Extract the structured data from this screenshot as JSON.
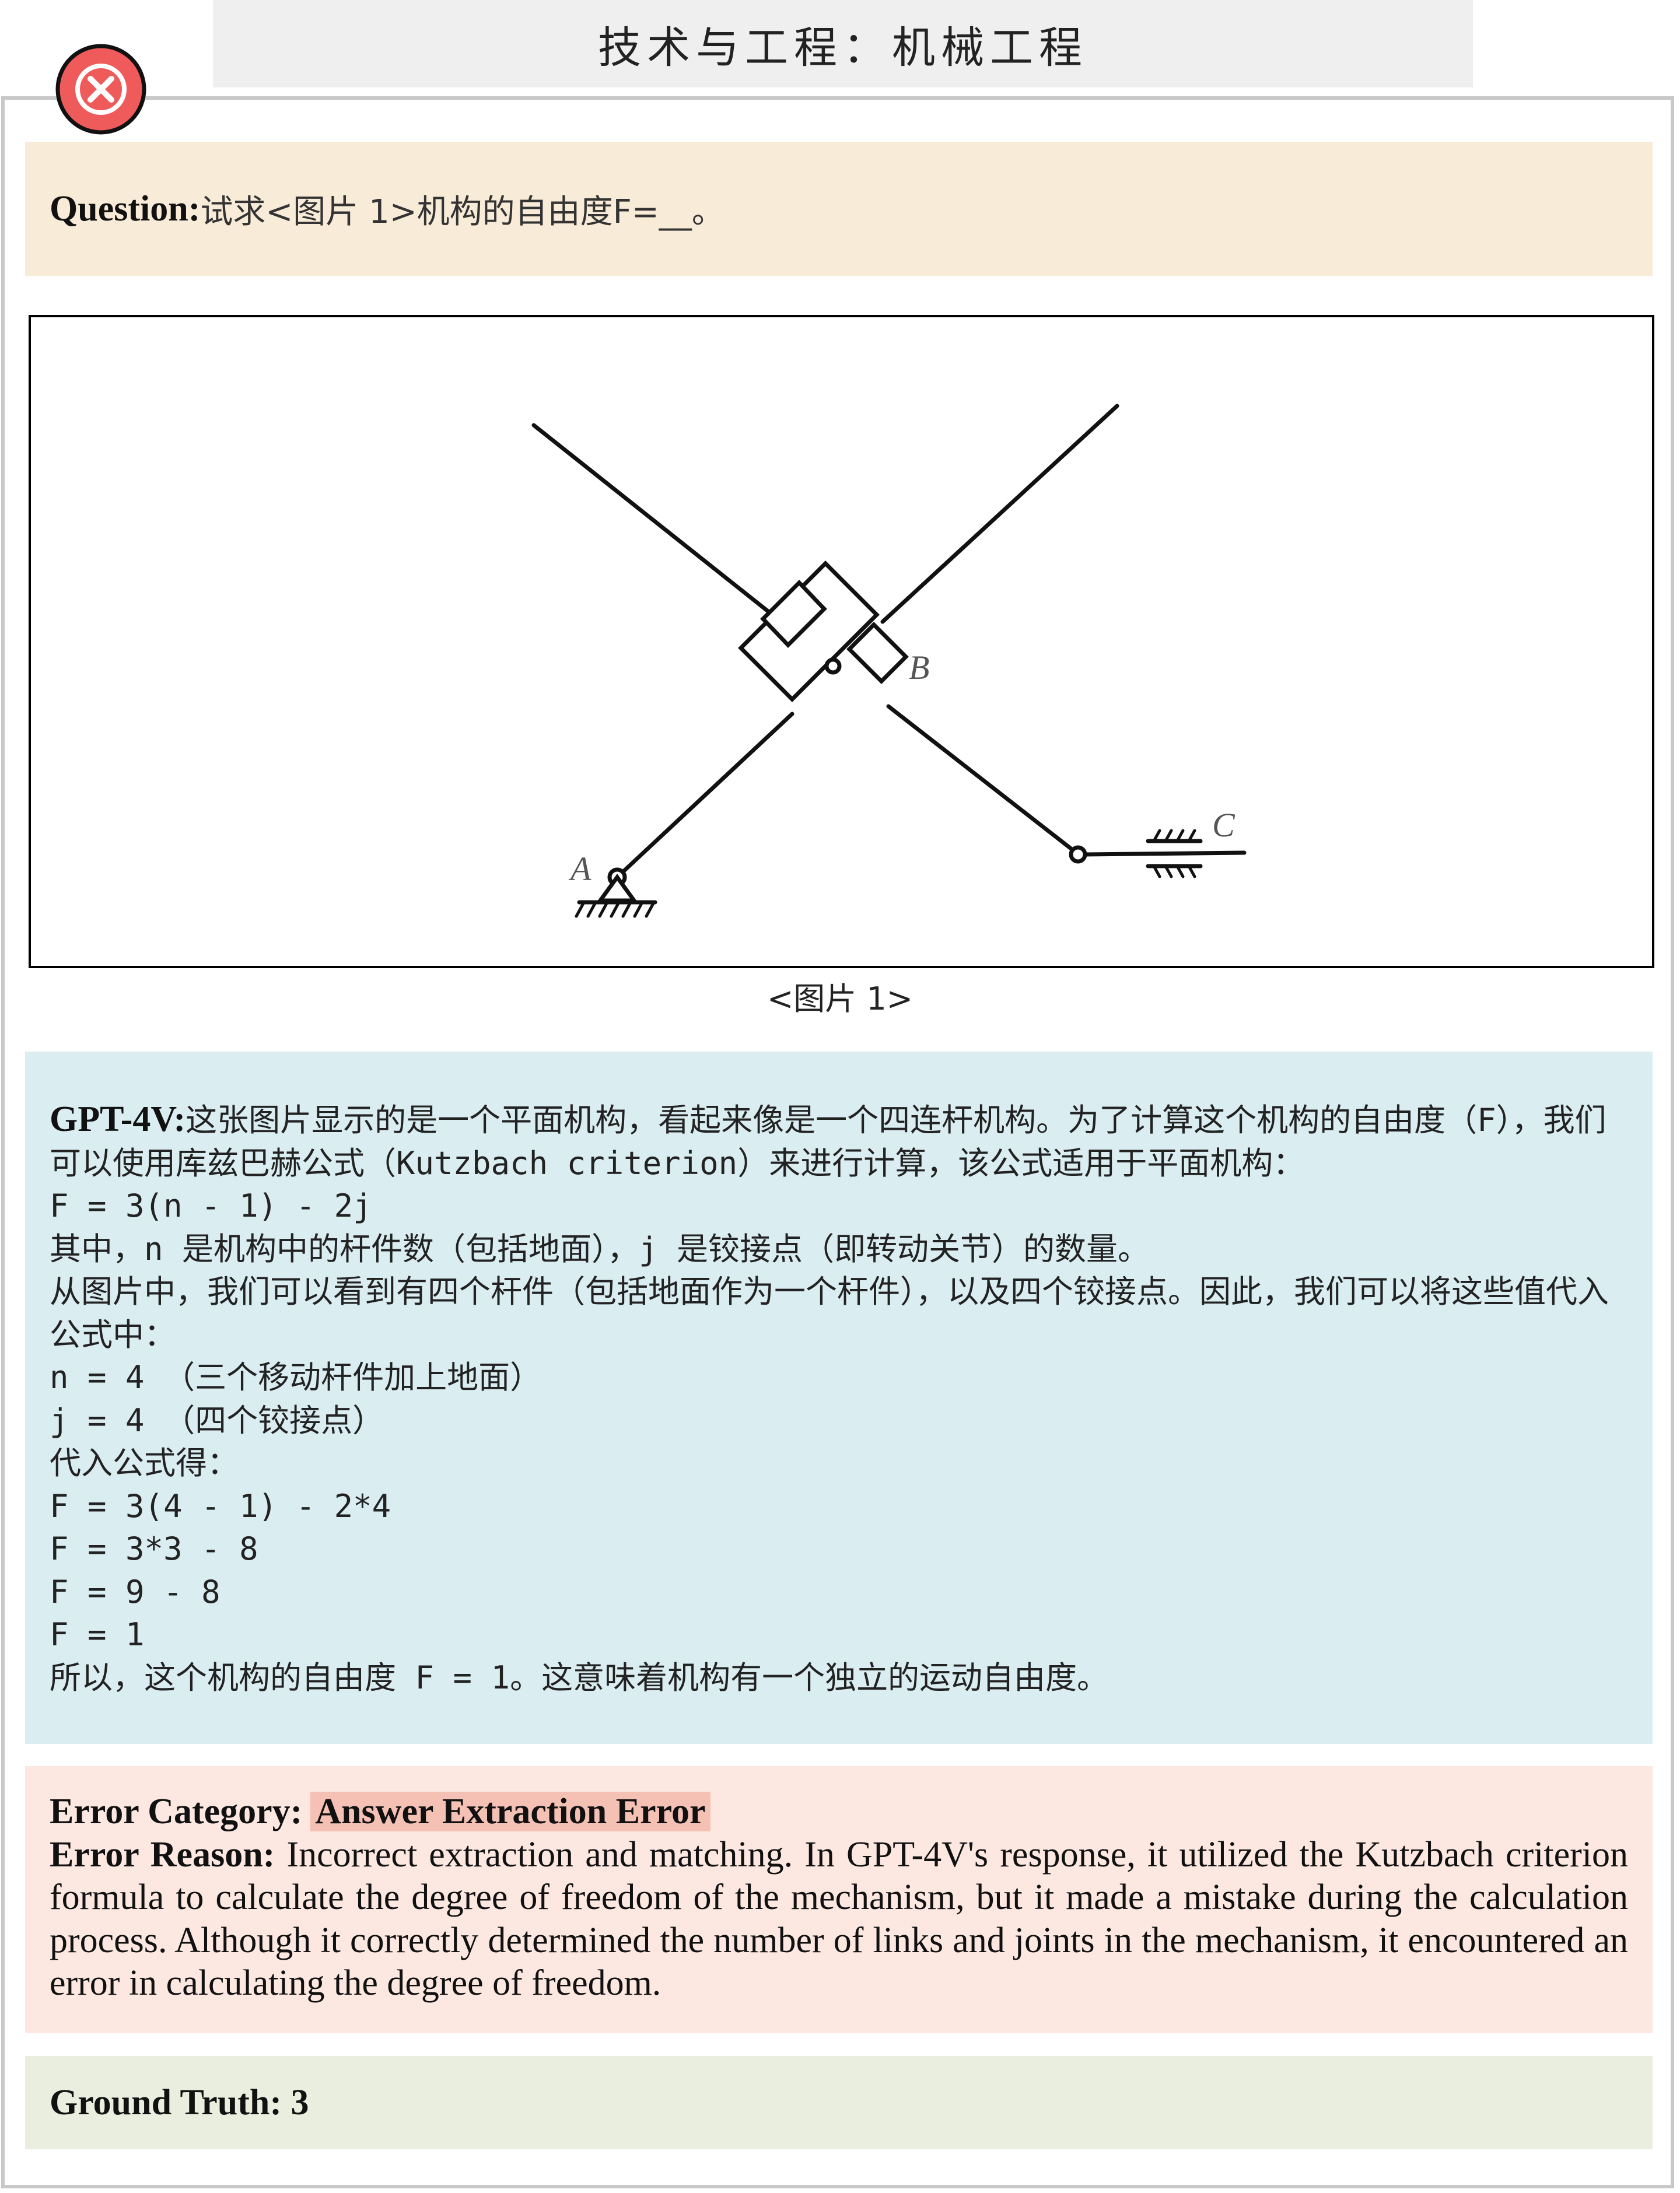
{
  "header": {
    "title": "技术与工程：机械工程"
  },
  "question": {
    "label": "Question:",
    "text": " 试求<图片 1>机构的自由度F=__。"
  },
  "figure": {
    "caption": "<图片 1>",
    "labels": {
      "a": "A",
      "b": "B",
      "c": "C"
    }
  },
  "answer": {
    "label": "GPT-4V:",
    "text": "这张图片显示的是一个平面机构，看起来像是一个四连杆机构。为了计算这个机构的自由度（F），我们可以使用库兹巴赫公式（Kutzbach criterion）来进行计算，该公式适用于平面机构：\nF = 3(n - 1) - 2j\n其中，n 是机构中的杆件数（包括地面），j 是铰接点（即转动关节）的数量。\n从图片中，我们可以看到有四个杆件（包括地面作为一个杆件），以及四个铰接点。因此，我们可以将这些值代入公式中：\nn = 4 （三个移动杆件加上地面）\nj = 4 （四个铰接点）\n代入公式得：\nF = 3(4 - 1) - 2*4\nF = 3*3 - 8\nF = 9 - 8\nF = 1\n所以，这个机构的自由度 F = 1。这意味着机构有一个独立的运动自由度。"
  },
  "error": {
    "category_label": "Error Category:",
    "category": "Answer Extraction Error",
    "reason_label": "Error Reason:",
    "reason": " Incorrect extraction and matching. In GPT-4V's response, it utilized the Kutzbach criterion formula to calculate the degree of freedom of the mechanism, but it made a mistake during the calculation process. Although it correctly determined the number of links and joints in the mechanism, it encountered an error in calculating the degree of freedom."
  },
  "ground_truth": {
    "label": "Ground Truth:",
    "value": "3"
  },
  "colors": {
    "question_bg": "#f8ebd7",
    "answer_bg": "#daedf1",
    "error_bg": "#fce7e1",
    "error_highlight": "#f6c1b5",
    "truth_bg": "#eaeedf",
    "close_badge": "#ef5a5a"
  },
  "icons": {
    "status": "close-icon"
  }
}
